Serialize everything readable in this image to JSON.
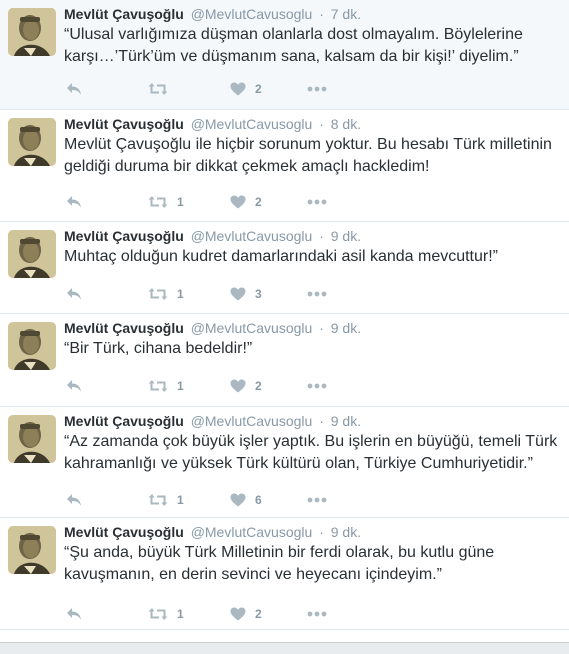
{
  "tweets": [
    {
      "fullname": "Mevlüt Çavuşoğlu",
      "username": "@MevlutCavusoglu",
      "sep": "·",
      "time": "7 dk.",
      "text": "“Ulusal varlığımıza düşman olanlarla dost olmayalım. Böylelerine karşı…’Türk’üm ve düşmanım sana, kalsam da bir kişi!’ diyelim.”",
      "retweets": "",
      "likes": "2"
    },
    {
      "fullname": "Mevlüt Çavuşoğlu",
      "username": "@MevlutCavusoglu",
      "sep": "·",
      "time": "8 dk.",
      "text": "Mevlüt Çavuşoğlu ile hiçbir sorunum yoktur. Bu hesabı Türk milletinin geldiği duruma bir dikkat çekmek amaçlı hackledim!",
      "retweets": "1",
      "likes": "2"
    },
    {
      "fullname": "Mevlüt Çavuşoğlu",
      "username": "@MevlutCavusoglu",
      "sep": "·",
      "time": "9 dk.",
      "text": "Muhtaç olduğun kudret damarlarındaki asil kanda mevcuttur!”",
      "retweets": "1",
      "likes": "3"
    },
    {
      "fullname": "Mevlüt Çavuşoğlu",
      "username": "@MevlutCavusoglu",
      "sep": "·",
      "time": "9 dk.",
      "text": "“Bir Türk, cihana bedeldir!”",
      "retweets": "1",
      "likes": "2"
    },
    {
      "fullname": "Mevlüt Çavuşoğlu",
      "username": "@MevlutCavusoglu",
      "sep": "·",
      "time": "9 dk.",
      "text": "“Az zamanda çok büyük işler yaptık. Bu işlerin en büyüğü, temeli Türk kahramanlığı ve yüksek Türk kültürü olan, Türkiye Cumhuriyetidir.”",
      "retweets": "1",
      "likes": "6"
    },
    {
      "fullname": "Mevlüt Çavuşoğlu",
      "username": "@MevlutCavusoglu",
      "sep": "·",
      "time": "9 dk.",
      "text": "“Şu anda, büyük Türk Milletinin bir ferdi olarak, bu kutlu güne kavuşmanın, en derin sevinci ve heyecanı içindeyim.”",
      "retweets": "1",
      "likes": "2"
    }
  ],
  "icons": {
    "reply": "reply-icon",
    "retweet": "retweet-icon",
    "like": "heart-icon",
    "more": "more-dots-icon",
    "avatar": "profile-avatar"
  },
  "colors": {
    "meta": "#8899a6",
    "text": "#292f33",
    "highlight_bg": "#f5f8fa",
    "divider": "#e1e8ed"
  }
}
